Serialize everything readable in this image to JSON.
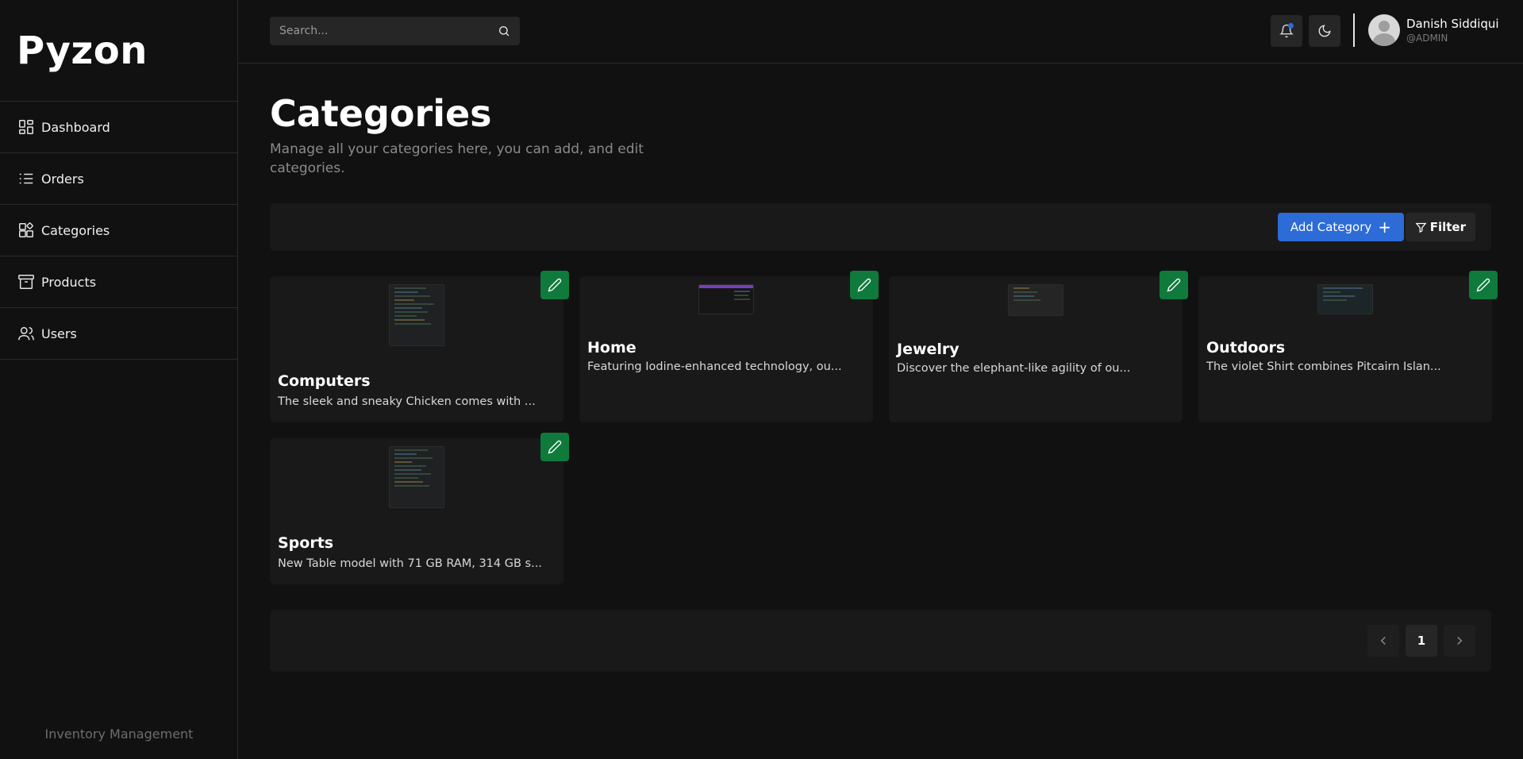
{
  "app": {
    "name": "Pyzon",
    "footer": "Inventory Management"
  },
  "sidebar": {
    "items": [
      {
        "label": "Dashboard",
        "icon": "dashboard-icon"
      },
      {
        "label": "Orders",
        "icon": "list-icon"
      },
      {
        "label": "Categories",
        "icon": "categories-icon"
      },
      {
        "label": "Products",
        "icon": "archive-icon"
      },
      {
        "label": "Users",
        "icon": "users-icon"
      }
    ]
  },
  "header": {
    "search_placeholder": "Search...",
    "user": {
      "name": "Danish Siddiqui",
      "role": "@ADMIN"
    }
  },
  "main": {
    "title": "Categories",
    "description": "Manage all your categories here, you can add, and edit categories.",
    "add_label": "Add Category",
    "filter_label": "Filter",
    "categories": [
      {
        "name": "Computers",
        "description": "The sleek and sneaky Chicken comes with ..."
      },
      {
        "name": "Home",
        "description": "Featuring Iodine-enhanced technology, ou..."
      },
      {
        "name": "Jewelry",
        "description": "Discover the elephant-like agility of ou..."
      },
      {
        "name": "Outdoors",
        "description": "The violet Shirt combines Pitcairn Islan..."
      },
      {
        "name": "Sports",
        "description": "New Table model with 71 GB RAM, 314 GB s..."
      }
    ],
    "pagination": {
      "current_page": "1"
    }
  },
  "colors": {
    "accent": "#2d6bd6",
    "edit": "#0f7a3b",
    "background": "#111111",
    "panel": "#191919"
  }
}
